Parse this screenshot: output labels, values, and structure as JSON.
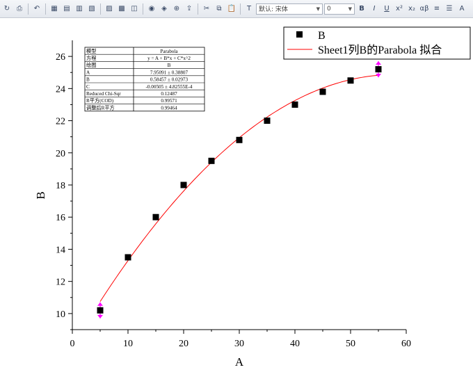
{
  "toolbar": {
    "font_name": "默认: 宋体",
    "font_size": "0",
    "bold": "B",
    "italic": "I",
    "underline": "U",
    "superscript": "x²",
    "subscript": "x₂",
    "greek": "αβ",
    "font_color": "A"
  },
  "colors": {
    "fit_line": "#ff0000",
    "marker": "#000000",
    "error_bar": "#ff00ff"
  },
  "stats_table": {
    "rows": [
      [
        "模型",
        "Parabola"
      ],
      [
        "方程",
        "y = A + B*x + C*x^2"
      ],
      [
        "绘图",
        "B"
      ],
      [
        "A",
        "7.95091 ± 0.38807"
      ],
      [
        "B",
        "0.58457 ± 0.02973"
      ],
      [
        "C",
        "-0.00505 ± 4.82555E-4"
      ],
      [
        "Reduced Chi-Sqr",
        "0.12487"
      ],
      [
        "R平方(COD)",
        "0.99571"
      ],
      [
        "调整后R平方",
        "0.99464"
      ]
    ]
  },
  "chart_data": {
    "type": "scatter",
    "xlabel": "A",
    "ylabel": "B",
    "xlim": [
      0,
      60
    ],
    "ylim": [
      9,
      27
    ],
    "x_ticks": [
      0,
      10,
      20,
      30,
      40,
      50,
      60
    ],
    "y_ticks": [
      10,
      12,
      14,
      16,
      18,
      20,
      22,
      24,
      26
    ],
    "grid": false,
    "legend_position": "top-right",
    "series": [
      {
        "name": "B",
        "kind": "scatter",
        "marker": "square",
        "x": [
          5,
          10,
          15,
          20,
          25,
          30,
          35,
          40,
          45,
          50,
          55
        ],
        "y": [
          10.2,
          13.5,
          16.0,
          18.0,
          19.5,
          20.8,
          22.0,
          23.0,
          23.8,
          24.5,
          25.2
        ]
      },
      {
        "name": "Sheet1列B的Parabola 拟合",
        "kind": "line",
        "model": "Parabola",
        "coefficients": {
          "A": 7.95091,
          "B": 0.58457,
          "C": -0.00505
        },
        "x_range": [
          5,
          55
        ]
      }
    ],
    "error_bars": [
      {
        "x": 5,
        "y": 10.2,
        "err": 0.5
      },
      {
        "x": 55,
        "y": 25.2,
        "err": 0.5
      }
    ]
  }
}
